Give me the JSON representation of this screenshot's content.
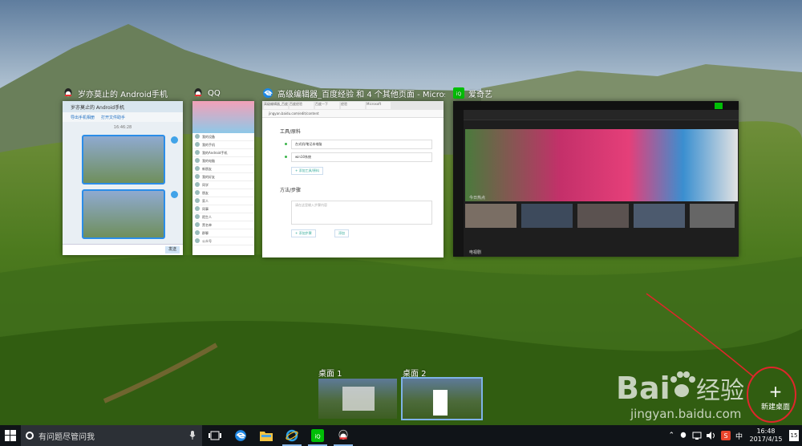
{
  "windows": [
    {
      "title": "岁亦莫止的 Android手机",
      "app": "QQ"
    },
    {
      "title": "QQ",
      "app": "QQ"
    },
    {
      "title": "高级编辑器_百度经验 和 4 个其他页面 - Microsoft...",
      "app": "Microsoft Edge"
    },
    {
      "title": "爱奇艺",
      "app": "iQIYI"
    }
  ],
  "qq_chat": {
    "header": "岁亦莫止的 Android手机",
    "tool_1": "导出手机相册",
    "tool_2": "打开文件助手",
    "date": "16:46:28",
    "send": "发送"
  },
  "qq_main": {
    "rows": [
      "我的设备",
      "我的手机",
      "我的Android手机",
      "我的电脑",
      "新朋友",
      "我的好友",
      "同学",
      "朋友",
      "家人",
      "同事",
      "陌生人",
      "黑名单",
      "群聊",
      "公众号"
    ]
  },
  "edge": {
    "tabs": [
      "高级编辑器_百度经验",
      "百度经验",
      "百度一下",
      "经验",
      "Microsoft"
    ],
    "address": "jingyan.baidu.com/edit/content",
    "section_tools": "工具/原料",
    "tool_items": [
      "台式机/笔记本电脑",
      "win10系统"
    ],
    "add_tool": "+ 添加工具/原料",
    "section_steps": "方法/步骤",
    "step_placeholder": "请在这里输入步骤内容",
    "add_step": "+ 添加步骤",
    "add_more": "添加"
  },
  "iqiyi": {
    "section_1": "今日热点",
    "section_2": "电视剧"
  },
  "desktops": [
    {
      "label": "桌面 1"
    },
    {
      "label": "桌面 2",
      "selected": true
    }
  ],
  "new_desktop": {
    "icon": "plus-icon",
    "label": "新建桌面"
  },
  "watermark": {
    "text": "Bai 经验",
    "url": "jingyan.baidu.com"
  },
  "taskbar": {
    "search_placeholder": "有问题尽管问我",
    "pinned": [
      "edge-icon",
      "file-explorer-icon",
      "ie-icon",
      "iqiyi-icon",
      "qq-icon"
    ],
    "tray": {
      "ime": "中",
      "time": "16:48",
      "date": "2017/4/15",
      "notifications": "15"
    }
  },
  "colors": {
    "taskbar": "#101418",
    "accent": "#7fb2e8",
    "iqiyi_green": "#00be06",
    "annotation_red": "#e0262b"
  }
}
